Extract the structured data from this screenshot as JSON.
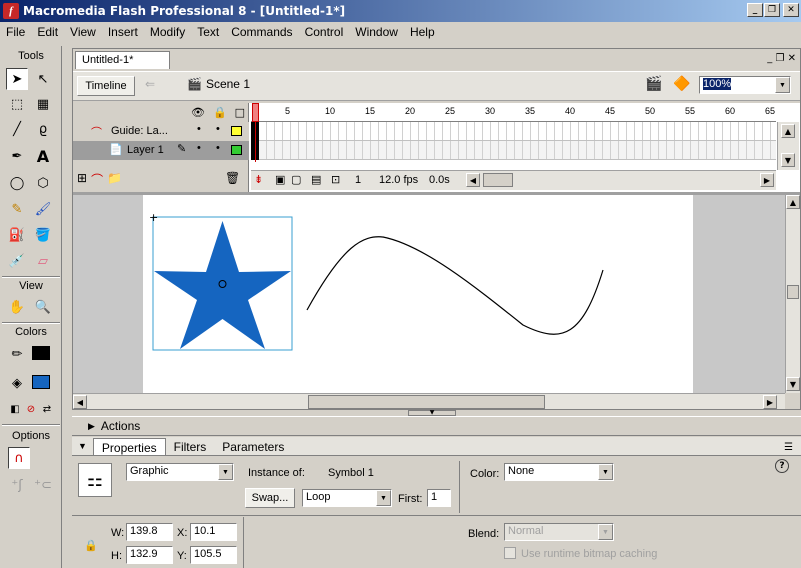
{
  "window": {
    "title": "Macromedia Flash Professional 8 - [Untitled-1*]",
    "app_icon_letter": "f"
  },
  "menu": [
    "File",
    "Edit",
    "View",
    "Insert",
    "Modify",
    "Text",
    "Commands",
    "Control",
    "Window",
    "Help"
  ],
  "tools": {
    "header": "Tools",
    "view_header": "View",
    "colors_header": "Colors",
    "options_header": "Options",
    "stroke_color": "#000000",
    "fill_color": "#1565c0"
  },
  "document": {
    "tab": "Untitled-1*",
    "timeline_button": "Timeline",
    "scene": "Scene 1",
    "zoom": "100%"
  },
  "timeline": {
    "frame_numbers": [
      "1",
      "5",
      "10",
      "15",
      "20",
      "25",
      "30",
      "35",
      "40",
      "45",
      "50",
      "55",
      "60",
      "65"
    ],
    "layers": [
      {
        "name": "Guide: La...",
        "type": "guide"
      },
      {
        "name": "Layer 1",
        "type": "normal",
        "color": "#33cc33"
      }
    ],
    "guide_color": "#ffff33",
    "current_frame": "1",
    "fps": "12.0 fps",
    "elapsed": "0.0s"
  },
  "panels": {
    "actions": "Actions",
    "tabs": [
      "Properties",
      "Filters",
      "Parameters"
    ],
    "symbol_type": "Graphic",
    "instance_of_label": "Instance of:",
    "instance_of_value": "Symbol 1",
    "swap_button": "Swap...",
    "loop_mode": "Loop",
    "first_label": "First:",
    "first_value": "1",
    "color_label": "Color:",
    "color_value": "None",
    "w_label": "W:",
    "w_value": "139.8",
    "h_label": "H:",
    "h_value": "132.9",
    "x_label": "X:",
    "x_value": "10.1",
    "y_label": "Y:",
    "y_value": "105.5",
    "blend_label": "Blend:",
    "blend_value": "Normal",
    "cache_label": "Use runtime bitmap caching"
  }
}
